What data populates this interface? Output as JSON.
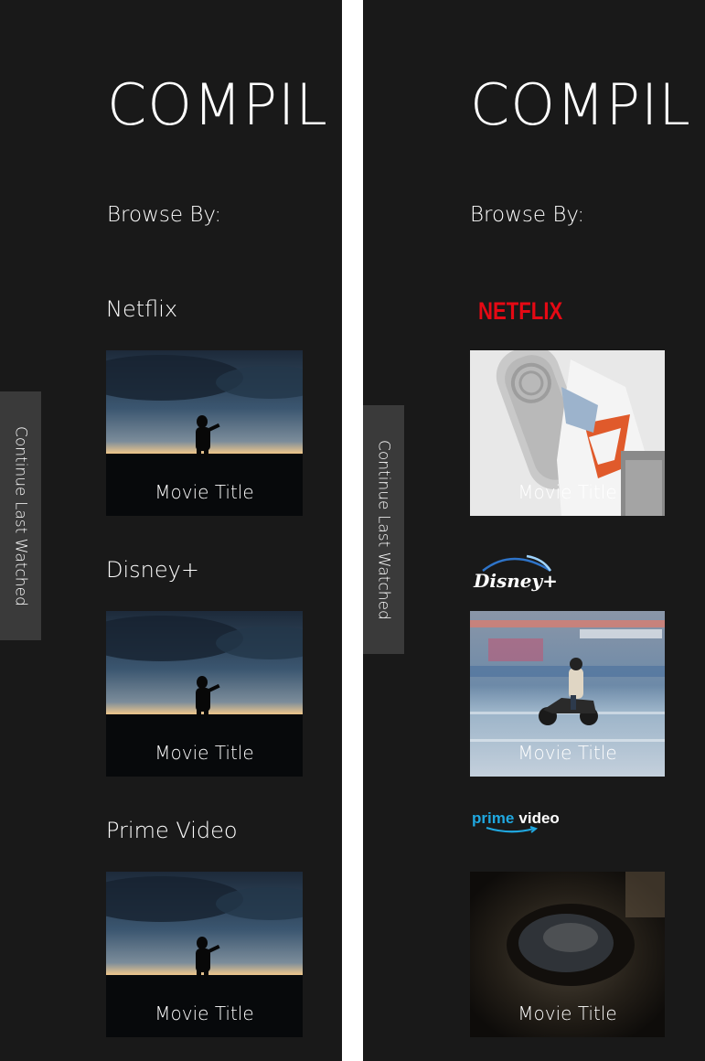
{
  "app": {
    "title": "COMPIL"
  },
  "browse": {
    "label": "Browse By:"
  },
  "side_tab": {
    "label": "Continue Last Watched"
  },
  "left_panel": {
    "sections": [
      {
        "label": "Netflix",
        "tile": {
          "caption": "Movie Title"
        }
      },
      {
        "label": "Disney+",
        "tile": {
          "caption": "Movie Title"
        }
      },
      {
        "label": "Prime Video",
        "tile": {
          "caption": "Movie Title"
        }
      }
    ]
  },
  "right_panel": {
    "sections": [
      {
        "logo_text": "NETFLIX",
        "logo_color": "#e50914",
        "tile": {
          "caption": "Movie Title"
        }
      },
      {
        "logo_text": "Disney+",
        "tile": {
          "caption": "Movie Title"
        }
      },
      {
        "logo_text_1": "prime",
        "logo_text_2": "video",
        "logo_color": "#20a8e0",
        "tile": {
          "caption": "Movie Title"
        }
      }
    ]
  },
  "colors": {
    "background": "#191919",
    "side_tab": "#3a3a3a",
    "text": "#ffffff"
  }
}
